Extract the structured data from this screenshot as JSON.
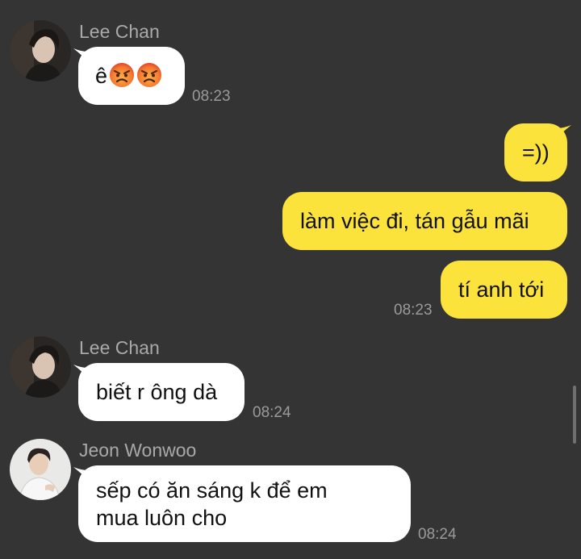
{
  "messages": [
    {
      "sender": "Lee Chan",
      "avatar_icon": "avatar-lee-chan",
      "text": "ê",
      "emojis": [
        "angry-face-icon",
        "angry-face-icon"
      ],
      "time": "08:23"
    },
    {
      "outgoing": [
        {
          "text": "=))"
        },
        {
          "text": "làm việc đi, tán gẫu mãi"
        },
        {
          "text": "tí anh tới"
        }
      ],
      "time": "08:23"
    },
    {
      "sender": "Lee Chan",
      "avatar_icon": "avatar-lee-chan",
      "text": "biết r ông dà",
      "time": "08:24"
    },
    {
      "sender": "Jeon Wonwoo",
      "avatar_icon": "avatar-jeon-wonwoo",
      "text_lines": [
        "sếp có ăn sáng k để em",
        "mua luôn cho"
      ],
      "time": "08:24"
    }
  ],
  "colors": {
    "background": "#333433",
    "incoming_bubble": "#ffffff",
    "outgoing_bubble": "#fbe33b",
    "name_text": "#a9a9a9",
    "time_text": "#9a9a9a"
  }
}
